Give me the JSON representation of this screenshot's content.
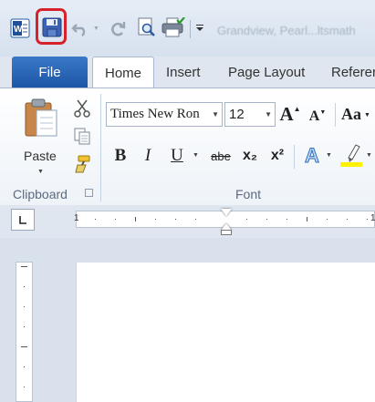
{
  "qat": {
    "app_icon": "word-icon",
    "icons": [
      "save-icon",
      "undo-icon",
      "redo-icon",
      "print-preview-icon",
      "print-icon",
      "customize-qat-icon"
    ],
    "blurred_title": "Grandview, Pearl...ltsmath"
  },
  "tabs": {
    "file": "File",
    "home": "Home",
    "insert": "Insert",
    "page_layout": "Page Layout",
    "references": "Referen"
  },
  "clipboard": {
    "paste_label": "Paste",
    "group_label": "Clipboard"
  },
  "font": {
    "family": "Times New Ron",
    "size": "12",
    "grow_label": "A",
    "shrink_label": "A",
    "change_case_label": "Aa",
    "bold": "B",
    "italic": "I",
    "underline": "U",
    "strikethrough": "abe",
    "subscript": "x₂",
    "superscript": "x²",
    "text_effects": "A",
    "group_label": "Font"
  },
  "ruler": {
    "left_number": "1",
    "right_number": "1"
  },
  "colors": {
    "file_tab": "#2a66b6",
    "highlight_outline": "#d6222b",
    "highlighter_yellow": "#fff200"
  }
}
